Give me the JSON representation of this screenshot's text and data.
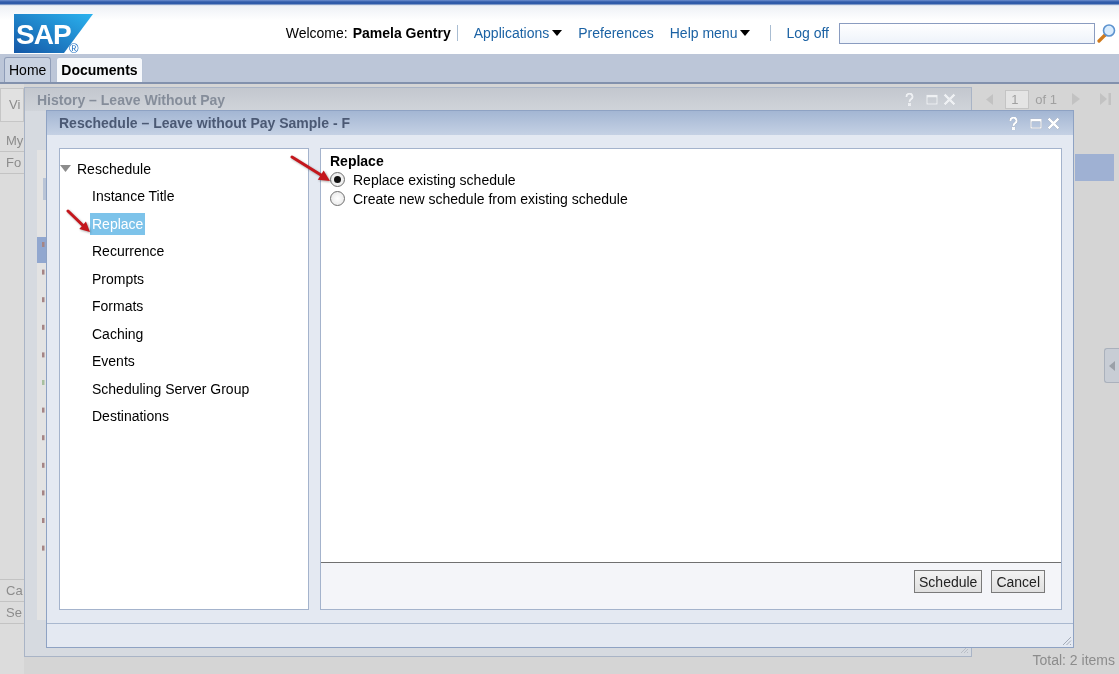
{
  "header": {
    "logo": {
      "text": "SAP",
      "mark": "®"
    },
    "welcome": {
      "label": "Welcome:",
      "user": "Pamela Gentry"
    },
    "menus": [
      {
        "label": "Applications",
        "kind": "dropdown"
      },
      {
        "label": "Preferences",
        "kind": "link"
      },
      {
        "label": "Help menu",
        "kind": "dropdown"
      }
    ],
    "logoff": "Log off"
  },
  "tabs": [
    {
      "label": "Home",
      "selected": false
    },
    {
      "label": "Documents",
      "selected": true
    }
  ],
  "background": {
    "left_panel": {
      "toolbar_label": "Vi",
      "top_items": [
        "My",
        "Fo"
      ],
      "bottom_items": [
        "Ca",
        "Se"
      ]
    },
    "history_dialog": {
      "title": "History – Leave Without Pay"
    },
    "pager": {
      "page": "1",
      "page_count": "of 1"
    },
    "status": "Total: 2 items"
  },
  "dialog": {
    "title": "Reschedule – Leave without Pay Sample - F",
    "tree": [
      {
        "label": "Reschedule",
        "selected": false,
        "expanded": true,
        "children": [
          {
            "label": "Instance Title",
            "selected": false
          },
          {
            "label": "Replace",
            "selected": true
          },
          {
            "label": "Recurrence",
            "selected": false
          },
          {
            "label": "Prompts",
            "selected": false
          },
          {
            "label": "Formats",
            "selected": false
          },
          {
            "label": "Caching",
            "selected": false
          },
          {
            "label": "Events",
            "selected": false
          },
          {
            "label": "Scheduling Server Group",
            "selected": false
          },
          {
            "label": "Destinations",
            "selected": false
          }
        ]
      }
    ],
    "section_title": "Replace",
    "options": [
      {
        "label": "Replace existing schedule",
        "selected": true
      },
      {
        "label": "Create new schedule from existing schedule",
        "selected": false
      }
    ],
    "buttons": [
      "Schedule",
      "Cancel"
    ]
  }
}
